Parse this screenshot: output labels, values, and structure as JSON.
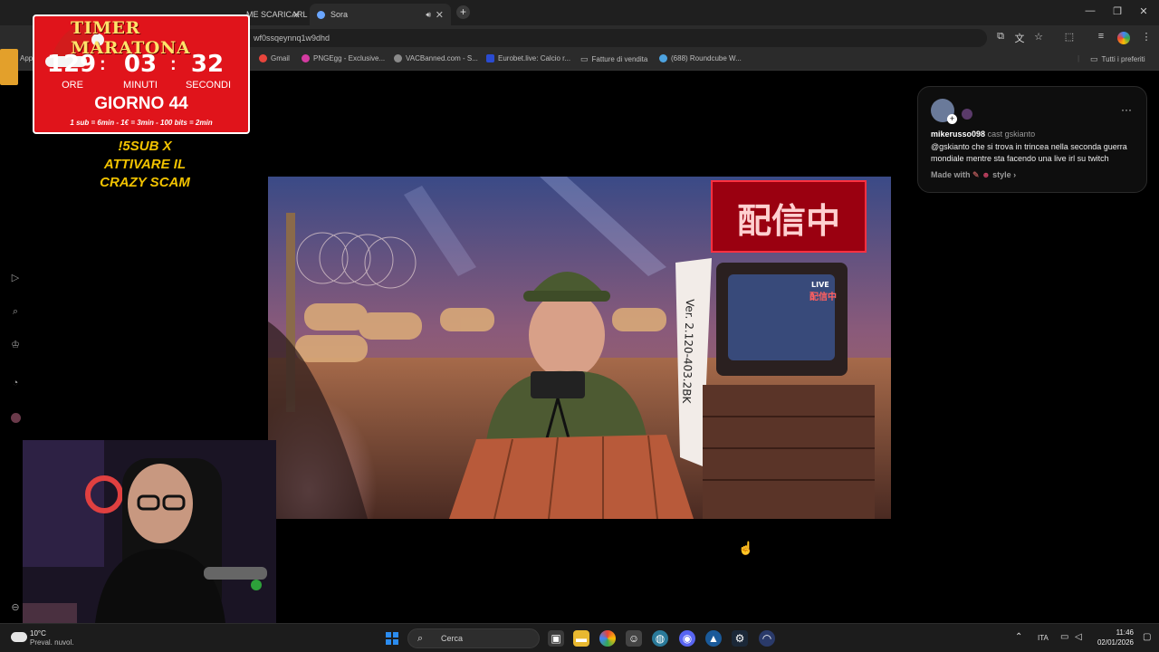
{
  "browser": {
    "tabs": [
      {
        "label": "ME SCARICARL",
        "active": false
      },
      {
        "label": "Sora",
        "active": true
      }
    ],
    "url_text": "wf0ssqeynnq1w9dhd",
    "bookmarks": [
      {
        "label": "Gmail",
        "color": "#e8453c"
      },
      {
        "label": "PNGEgg - Exclusive...",
        "color": "#d43ba1"
      },
      {
        "label": "VACBanned.com - S...",
        "color": "#8a8a8a"
      },
      {
        "label": "Eurobet.live: Calcio r...",
        "color": "#2a4bd1"
      },
      {
        "label": "Fatture di vendita",
        "color": "#9a9a9a"
      },
      {
        "label": "(688) Roundcube W...",
        "color": "#4da3e0"
      }
    ],
    "all_bookmarks_label": "Tutti i preferiti",
    "apps_label": "App"
  },
  "timer": {
    "title": "TIMER MARATONA",
    "hours": "129",
    "minutes": "03",
    "seconds": "32",
    "hours_label": "ORE",
    "minutes_label": "MINUTI",
    "seconds_label": "SECONDI",
    "day": "GIORNO 44",
    "rates": "1 sub = 6min - 1€ = 3min - 100 bits = 2min"
  },
  "promo": {
    "line1": "!5SUB X",
    "line2": "ATTIVARE IL",
    "line3": "CRAZY SCAM"
  },
  "video": {
    "neon_sign": "配信中",
    "tv_live": "LIVE",
    "tv_sign": "配信中",
    "banner": "Ver. 2.120-403.2BK"
  },
  "post": {
    "username": "mikerusso098",
    "cast": "cast gskianto",
    "text": "@gskianto che si trova in trincea nella seconda guerra mondiale mentre sta facendo una live irl su twitch",
    "made_with": "Made with",
    "style": "style",
    "more": "···"
  },
  "taskbar": {
    "temperature": "10°C",
    "weather": "Preval. nuvol.",
    "search_placeholder": "Cerca",
    "language": "ITA",
    "time": "11:46",
    "date": "02/01/2026"
  },
  "colors": {
    "timer_bg": "#e0141b",
    "promo_text": "#f2c300",
    "windows_blue": "#2b8cf0"
  }
}
